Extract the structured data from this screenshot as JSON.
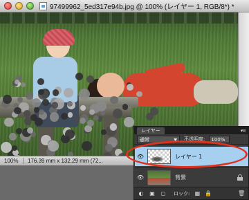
{
  "window": {
    "title": "97499962_5ed317e94b.jpg @ 100% (レイヤー 1, RGB/8*) *"
  },
  "status_bar": {
    "zoom": "100%",
    "doc_info": "176.39 mm x 132.29 mm (72..."
  },
  "layers_panel": {
    "tab_label": "レイヤー",
    "menu_icon": "panel-menu-icon",
    "blend_mode": "通常",
    "opacity_label": "不透明度:",
    "opacity_value": "100%",
    "lock_label": "ロック:",
    "layers": [
      {
        "name": "レイヤー 1",
        "selected": true,
        "visible": true,
        "locked": false
      },
      {
        "name": "背景",
        "selected": false,
        "visible": true,
        "locked": true
      }
    ]
  },
  "colors": {
    "highlight": "#e0301e",
    "selected_layer": "#a7d0f0"
  }
}
